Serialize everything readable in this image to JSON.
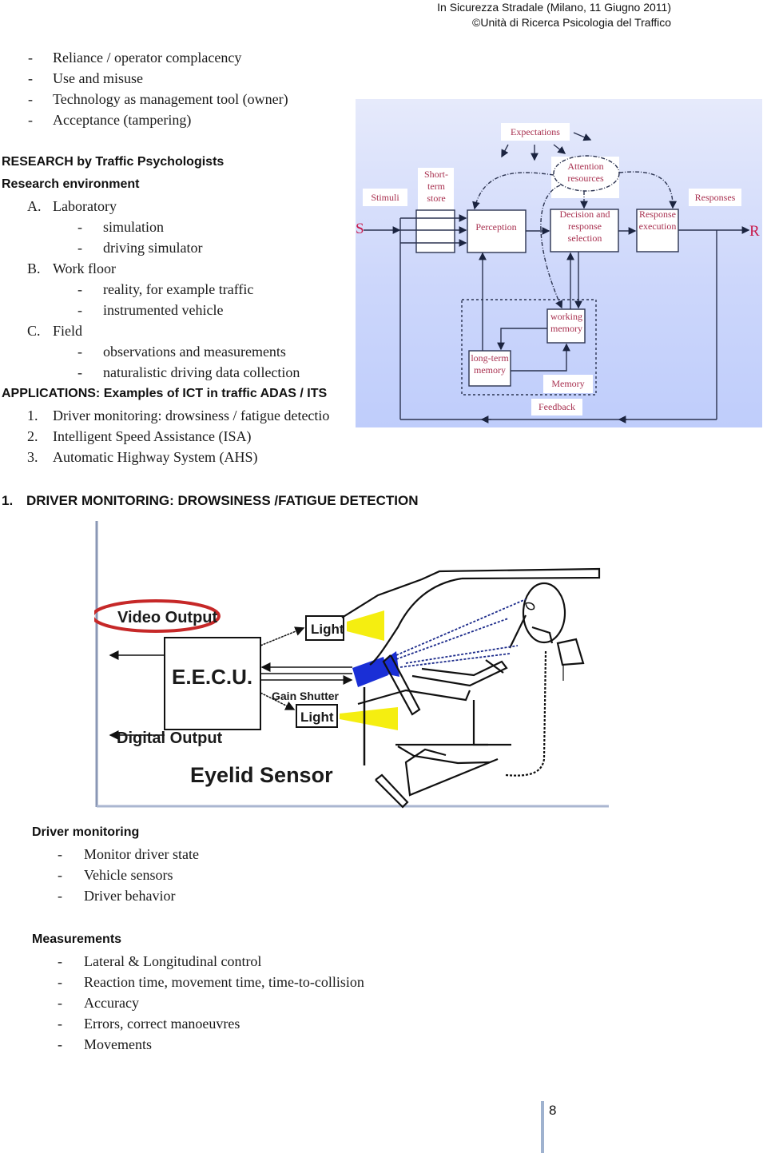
{
  "header": {
    "line1": "In Sicurezza Stradale (Milano, 11 Giugno 2011)",
    "line2": "©Unità di Ricerca Psicologia del Traffico"
  },
  "intro_bullets": [
    "Reliance / operator complacency",
    "Use and misuse",
    "Technology as management tool (owner)",
    "Acceptance (tampering)"
  ],
  "research": {
    "heading": "RESEARCH by Traffic Psychologists",
    "subheading": "Research environment",
    "environments": [
      {
        "marker": "A.",
        "label": "Laboratory",
        "items": [
          "simulation",
          "driving simulator"
        ]
      },
      {
        "marker": "B.",
        "label": "Work floor",
        "items": [
          "reality, for example traffic",
          "instrumented vehicle"
        ]
      },
      {
        "marker": "C.",
        "label": "Field",
        "items": [
          "observations and measurements",
          "naturalistic driving data collection"
        ]
      }
    ]
  },
  "applications": {
    "heading": "APPLICATIONS: Examples of ICT in traffic ADAS / ITS",
    "items": [
      {
        "marker": "1.",
        "label": "Driver monitoring: drowsiness / fatigue detectio"
      },
      {
        "marker": "2.",
        "label": "Intelligent Speed Assistance (ISA)"
      },
      {
        "marker": "3.",
        "label": "Automatic Highway System (AHS)"
      }
    ]
  },
  "diagram": {
    "stimulus": "S",
    "response": "R",
    "expectations": "Expectations",
    "attention": [
      "Attention",
      "resources"
    ],
    "stimuli": "Stimuli",
    "short_term_store": [
      "Short-",
      "term",
      "store"
    ],
    "perception": "Perception",
    "decision": [
      "Decision and",
      "response",
      "selection"
    ],
    "response_execution": [
      "Response",
      "execution"
    ],
    "responses": "Responses",
    "working_memory": [
      "working",
      "memory"
    ],
    "long_term_memory": [
      "long-term",
      "memory"
    ],
    "memory": "Memory",
    "feedback": "Feedback",
    "colors": {
      "label": "#a8304f",
      "sr": "#c8194a",
      "bg_top": "#e6eafb",
      "bg_bottom": "#bfcdfb"
    }
  },
  "section1": {
    "marker": "1.",
    "heading": "DRIVER MONITORING: DROWSINESS /FATIGUE DETECTION"
  },
  "eyelid_figure": {
    "video_output": "Video Output",
    "light_top": "Light",
    "eecu": "E.E.C.U.",
    "gain_shutter": "Gain Shutter",
    "light_bottom": "Light",
    "digital_output": "Digital Output",
    "title": "Eyelid Sensor",
    "colors": {
      "ellipse": "#c62828",
      "camera": "#1a2fd6",
      "light_beam": "#f5ee10"
    }
  },
  "driver_monitoring": {
    "heading": "Driver monitoring",
    "items": [
      "Monitor driver state",
      "Vehicle sensors",
      "Driver behavior"
    ]
  },
  "measurements": {
    "heading": "Measurements",
    "items": [
      "Lateral & Longitudinal control",
      "Reaction time, movement time, time-to-collision",
      "Accuracy",
      "Errors, correct manoeuvres",
      "Movements"
    ]
  },
  "page_number": "8"
}
